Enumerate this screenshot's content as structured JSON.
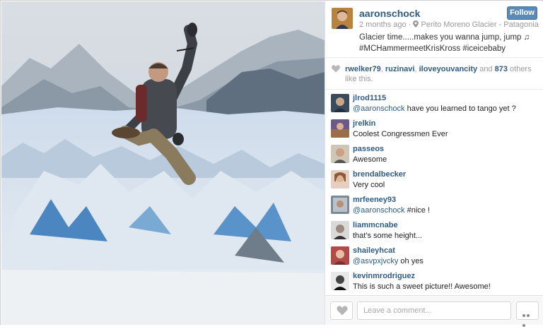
{
  "post": {
    "username": "aaronschock",
    "follow_label": "Follow",
    "time": "2 months ago",
    "location": "Perito Moreno Glacier - Patagonia",
    "caption_line1": "Glacier time.....makes you wanna jump, jump ♫",
    "caption_line2": "#MCHammermeetKrisKross #iceicebaby"
  },
  "likes": {
    "users": [
      "rwelker79",
      "ruzinavi",
      "iloveyouvancity"
    ],
    "sep1": ", ",
    "sep2": ", ",
    "and_text": " and ",
    "others_count": "873",
    "others_suffix": " others like this."
  },
  "comments": [
    {
      "user": "jlrod1115",
      "mention": "@aaronschock",
      "text": " have you learned to tango yet ?"
    },
    {
      "user": "jrelkin",
      "mention": "",
      "text": "Coolest Congressmen Ever"
    },
    {
      "user": "passeos",
      "mention": "",
      "text": "Awesome"
    },
    {
      "user": "brendalbecker",
      "mention": "",
      "text": "Very cool"
    },
    {
      "user": "mrfeeney93",
      "mention": "@aaronschock",
      "text": " #nice !"
    },
    {
      "user": "liammcnabe",
      "mention": "",
      "text": "that's some height..."
    },
    {
      "user": "shaileyhcat",
      "mention": "@asvpxjvcky",
      "text": " oh yes"
    },
    {
      "user": "kevinmrodriguez",
      "mention": "",
      "text": "This is such a sweet picture!! Awesome!"
    }
  ],
  "footer": {
    "comment_placeholder": "Leave a comment..."
  },
  "icons": {
    "location": "location-pin-icon",
    "heart": "heart-icon",
    "more": "more-options-icon"
  },
  "colors": {
    "link": "#2f5b84",
    "follow": "#5a8bb8"
  }
}
